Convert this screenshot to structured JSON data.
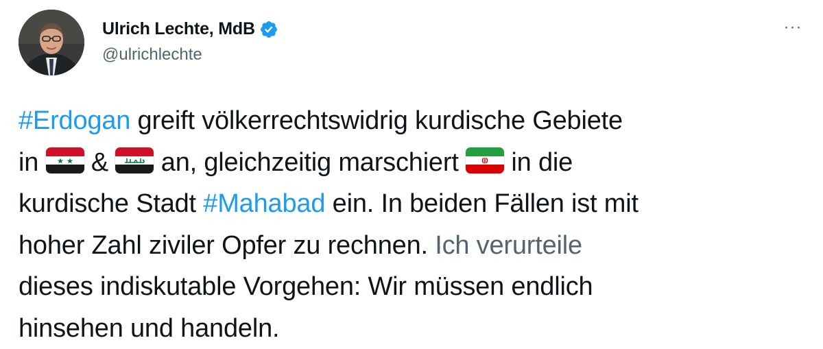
{
  "author": {
    "display_name": "Ulrich Lechte, MdB",
    "handle": "@ulrichlechte",
    "verified_icon": "verified-badge-icon",
    "avatar_icon": "profile-photo"
  },
  "more_menu": {
    "label": "···",
    "icon": "more-options-icon"
  },
  "tweet": {
    "hashtag_1": "#Erdogan",
    "text_1": " greift völkerrechtswidrig kurdische Gebiete",
    "text_2a": "in ",
    "flag_1": "syria-flag",
    "text_2b": " & ",
    "flag_2": "iraq-flag",
    "text_2c": " an, gleichzeitig marschiert ",
    "flag_3": "iran-flag",
    "text_2d": " in die",
    "text_3a": "kurdische Stadt ",
    "hashtag_2": "#Mahabad",
    "text_3b": " ein. In beiden Fällen ist mit",
    "text_4a": "hoher Zahl ziviler Opfer zu rechnen. ",
    "text_4b": "Ich verurteile",
    "text_5": "dieses indiskutable Vorgehen: Wir müssen endlich",
    "text_6": "hinsehen und handeln."
  },
  "colors": {
    "hashtag": "#1d9bf0",
    "secondary_text": "#536471",
    "primary_text": "#0f1419",
    "verified": "#1d9bf0"
  }
}
